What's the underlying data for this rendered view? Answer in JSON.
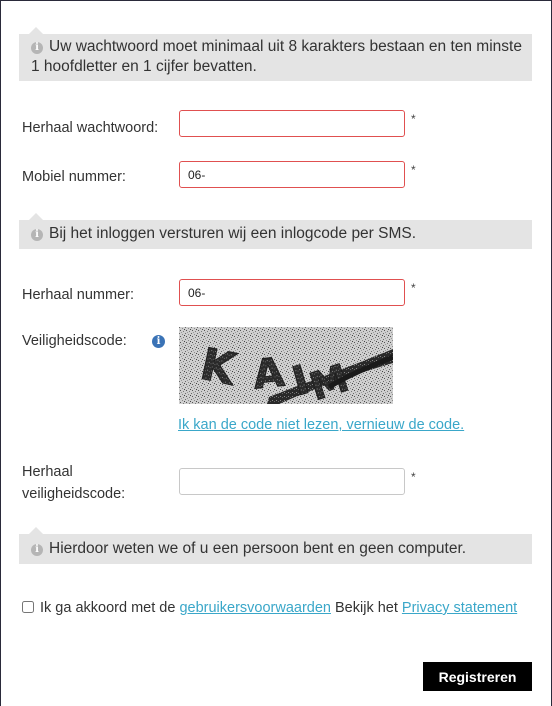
{
  "password_hint": "Uw wachtwoord moet minimaal uit 8 karakters bestaan en ten minste 1 hoofdletter en 1 cijfer bevatten.",
  "repeat_password": {
    "label": "Herhaal wachtwoord:",
    "value": "",
    "required_mark": "*"
  },
  "mobile_number": {
    "label": "Mobiel nummer:",
    "value": "06-",
    "required_mark": "*"
  },
  "sms_hint": "Bij het inloggen versturen wij een inlogcode per SMS.",
  "repeat_number": {
    "label": "Herhaal nummer:",
    "value": "06-",
    "required_mark": "*"
  },
  "security_code": {
    "label": "Veiligheidscode:",
    "captcha_text": "KAIM",
    "renew_link": "Ik kan de code niet lezen, vernieuw de code."
  },
  "repeat_security_code": {
    "label_line1": "Herhaal",
    "label_line2": "veiligheidscode:",
    "value": "",
    "required_mark": "*"
  },
  "human_hint": "Hierdoor weten we of u een persoon bent en geen computer.",
  "agreement": {
    "text_before": "Ik ga akkoord met de",
    "terms_link": "gebruikersvoorwaarden",
    "text_middle": "Bekijk het",
    "privacy_link": "Privacy statement",
    "checked": false
  },
  "submit_label": "Registreren",
  "colors": {
    "error_border": "#e05050",
    "link": "#3aa7c9",
    "hint_background": "#e4e4e4",
    "help_icon": "#3a73b6"
  }
}
